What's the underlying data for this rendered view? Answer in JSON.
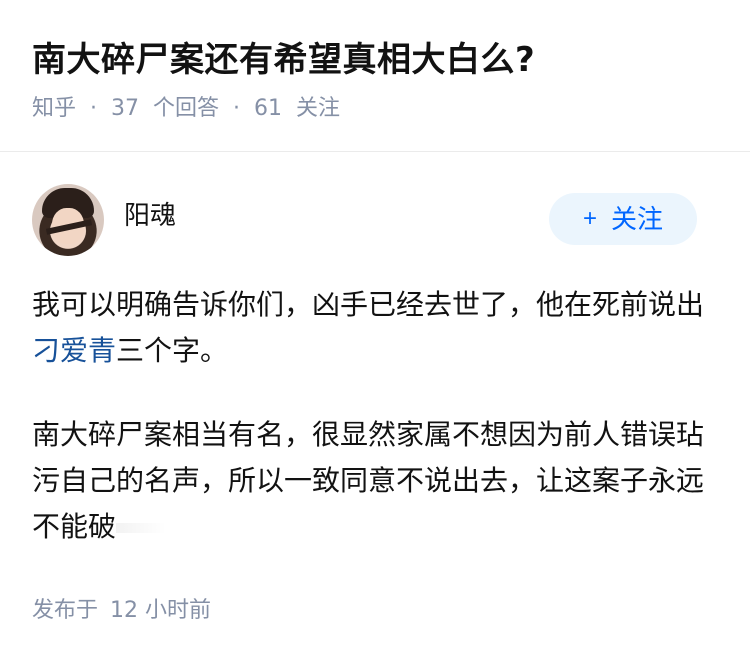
{
  "question": {
    "title": "南大碎尸案还有希望真相大白么?",
    "source": "知乎",
    "separator": "·",
    "answer_count": "37",
    "answer_label": "个回答",
    "follower_count": "61",
    "follower_label": "关注"
  },
  "author": {
    "name": "阳魂",
    "follow_button": {
      "icon": "+",
      "label": "关注"
    }
  },
  "answer": {
    "para1_before": "我可以明确告诉你们，凶手已经去世了，他在死前说出",
    "para1_link": "刁爱青",
    "para1_after": "三个字。",
    "para2": "南大碎尸案相当有名，很显然家属不想因为前人错误玷污自己的名声，所以一致同意不说出去，让这案子永远不能破"
  },
  "footer": {
    "label": "发布于",
    "time": "12 小时前"
  },
  "colors": {
    "meta_text": "#8590a6",
    "link": "#175199",
    "follow_bg": "#ebf5fd",
    "follow_text": "#0066ff"
  }
}
